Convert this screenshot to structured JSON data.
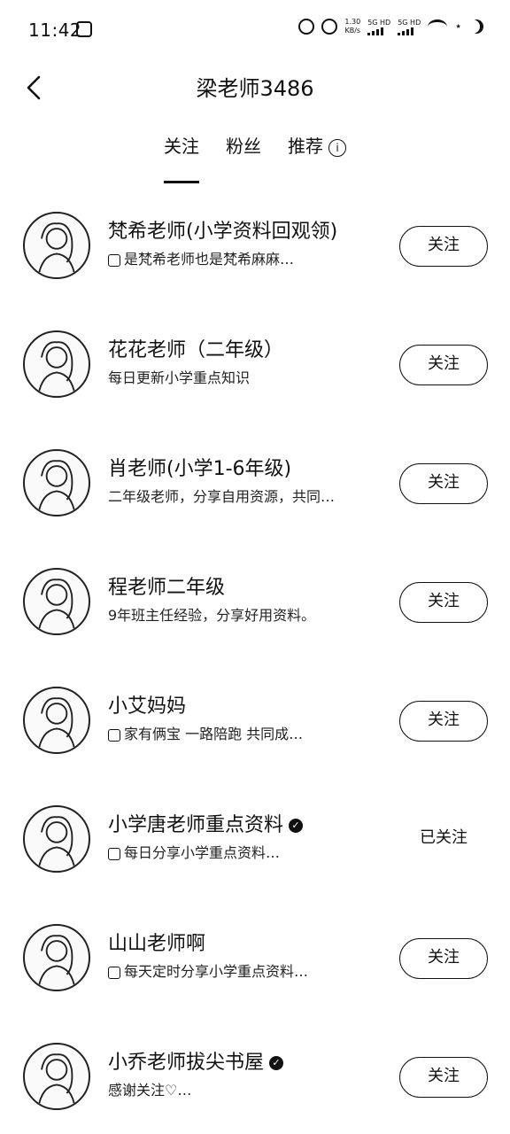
{
  "status_bar": {
    "time": "11:42",
    "net_speed": "1.30",
    "net_unit": "KB/s",
    "sig1": "5G HD",
    "sig2": "5G HD"
  },
  "header": {
    "title": "梁老师3486"
  },
  "tabs": [
    {
      "label": "关注",
      "active": true
    },
    {
      "label": "粉丝",
      "active": false
    },
    {
      "label": "推荐",
      "active": false
    }
  ],
  "items": [
    {
      "name": "梵希老师(小学资料回观领)",
      "desc": "是梵希老师也是梵希麻麻…",
      "button": "关注",
      "verified": false,
      "badge": true
    },
    {
      "name": "花花老师（二年级）",
      "desc": "每日更新小学重点知识",
      "button": "关注",
      "verified": false,
      "badge": false
    },
    {
      "name": "肖老师(小学1-6年级)",
      "desc": "二年级老师，分享自用资源，共同…",
      "button": "关注",
      "verified": false,
      "badge": false
    },
    {
      "name": "程老师二年级",
      "desc": "9年班主任经验，分享好用资料。",
      "button": "关注",
      "verified": false,
      "badge": false
    },
    {
      "name": "小艾妈妈",
      "desc": "家有俩宝 一路陪跑 共同成…",
      "button": "关注",
      "verified": false,
      "badge": true
    },
    {
      "name": "小学唐老师重点资料",
      "desc": "每日分享小学重点资料…",
      "button": "已关注",
      "verified": true,
      "badge": true
    },
    {
      "name": "山山老师啊",
      "desc": "每天定时分享小学重点资料…",
      "button": "关注",
      "verified": false,
      "badge": true
    },
    {
      "name": "小乔老师拔尖书屋",
      "desc": "感谢关注♡…",
      "button": "关注",
      "verified": true,
      "badge": false
    }
  ]
}
